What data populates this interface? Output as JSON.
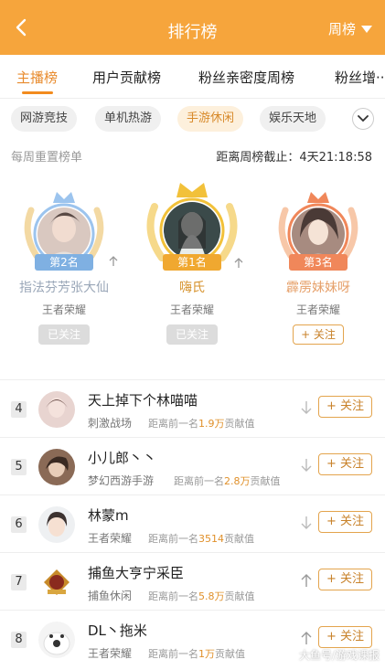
{
  "header": {
    "title": "排行榜",
    "period": "周榜"
  },
  "tabs": [
    {
      "label": "主播榜",
      "active": true
    },
    {
      "label": "用户贡献榜",
      "active": false
    },
    {
      "label": "粉丝亲密度周榜",
      "active": false
    },
    {
      "label": "粉丝增···",
      "active": false
    }
  ],
  "chips": [
    {
      "label": "网游竞技",
      "active": false
    },
    {
      "label": "单机热游",
      "active": false
    },
    {
      "label": "手游休闲",
      "active": true
    },
    {
      "label": "娱乐天地",
      "active": false
    }
  ],
  "info": {
    "left": "每周重置榜单",
    "right": "距离周榜截止：4天21:18:58"
  },
  "podium": [
    {
      "rank_label": "第2名",
      "name": "指法芬芳张大仙",
      "category": "王者荣耀",
      "button": "已关注",
      "followed": true,
      "trend": "up",
      "color": "#7fb0e2"
    },
    {
      "rank_label": "第1名",
      "name": "嗨氏",
      "category": "王者荣耀",
      "button": "已关注",
      "followed": true,
      "trend": "up",
      "color": "#f2c13a"
    },
    {
      "rank_label": "第3名",
      "name": "霹雳妹妹呀",
      "category": "王者荣耀",
      "button": "+ 关注",
      "followed": false,
      "trend": "up",
      "color": "#f0875a"
    }
  ],
  "list": [
    {
      "rank": "4",
      "name": "天上掉下个林喵喵",
      "category": "刺激战场",
      "dist_prefix": "距离前一名",
      "dist_value": "1.9万",
      "dist_suffix": "贡献值",
      "trend": "down",
      "button": "+ 关注"
    },
    {
      "rank": "5",
      "name": "小儿郎丶丶",
      "category": "梦幻西游手游",
      "dist_prefix": "距离前一名",
      "dist_value": "2.8万",
      "dist_suffix": "贡献值",
      "trend": "down",
      "button": "+ 关注"
    },
    {
      "rank": "6",
      "name": "林蒙m",
      "category": "王者荣耀",
      "dist_prefix": "距离前一名",
      "dist_value": "3514",
      "dist_suffix": "贡献值",
      "trend": "down",
      "button": "+ 关注"
    },
    {
      "rank": "7",
      "name": "捕鱼大亨宁采臣",
      "category": "捕鱼休闲",
      "dist_prefix": "距离前一名",
      "dist_value": "5.8万",
      "dist_suffix": "贡献值",
      "trend": "up",
      "button": "+ 关注"
    },
    {
      "rank": "8",
      "name": "DL丶拖米",
      "category": "王者荣耀",
      "dist_prefix": "距离前一名",
      "dist_value": "1万",
      "dist_suffix": "贡献值",
      "trend": "up",
      "button": "+ 关注"
    }
  ],
  "watermark": "大鱼号/游戏课报",
  "colors": {
    "accent": "#f6a53c",
    "highlight": "#e88b2e"
  }
}
